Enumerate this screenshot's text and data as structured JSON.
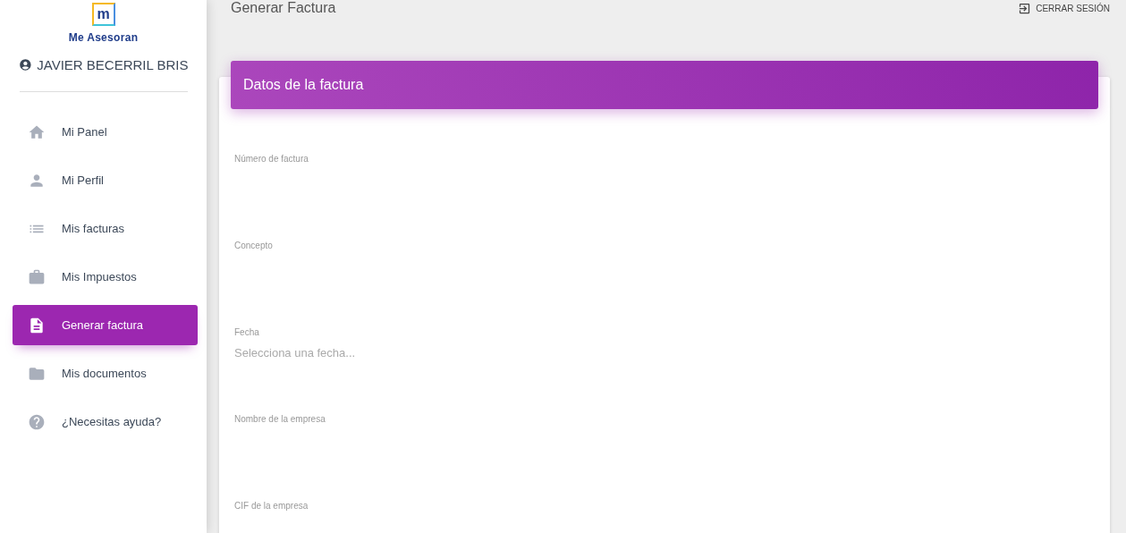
{
  "logo": {
    "mark": "m",
    "name": "Me Asesoran"
  },
  "user": {
    "name": "JAVIER BECERRIL BRIS"
  },
  "sidebar": {
    "items": [
      {
        "label": "Mi Panel",
        "selected": false
      },
      {
        "label": "Mi Perfil",
        "selected": false
      },
      {
        "label": "Mis facturas",
        "selected": false
      },
      {
        "label": "Mis Impuestos",
        "selected": false
      },
      {
        "label": "Generar factura",
        "selected": true
      },
      {
        "label": "Mis documentos",
        "selected": false
      },
      {
        "label": "¿Necesitas ayuda?",
        "selected": false
      }
    ]
  },
  "topbar": {
    "title": "Generar Factura",
    "logout": "CERRAR SESIÓN"
  },
  "card": {
    "title": "Datos de la factura",
    "fields": [
      {
        "label": "Número de factura"
      },
      {
        "label": "Concepto"
      },
      {
        "label": "Fecha",
        "placeholder": "Selecciona una fecha..."
      },
      {
        "label": "Nombre de la empresa"
      },
      {
        "label": "CIF de la empresa"
      }
    ]
  }
}
